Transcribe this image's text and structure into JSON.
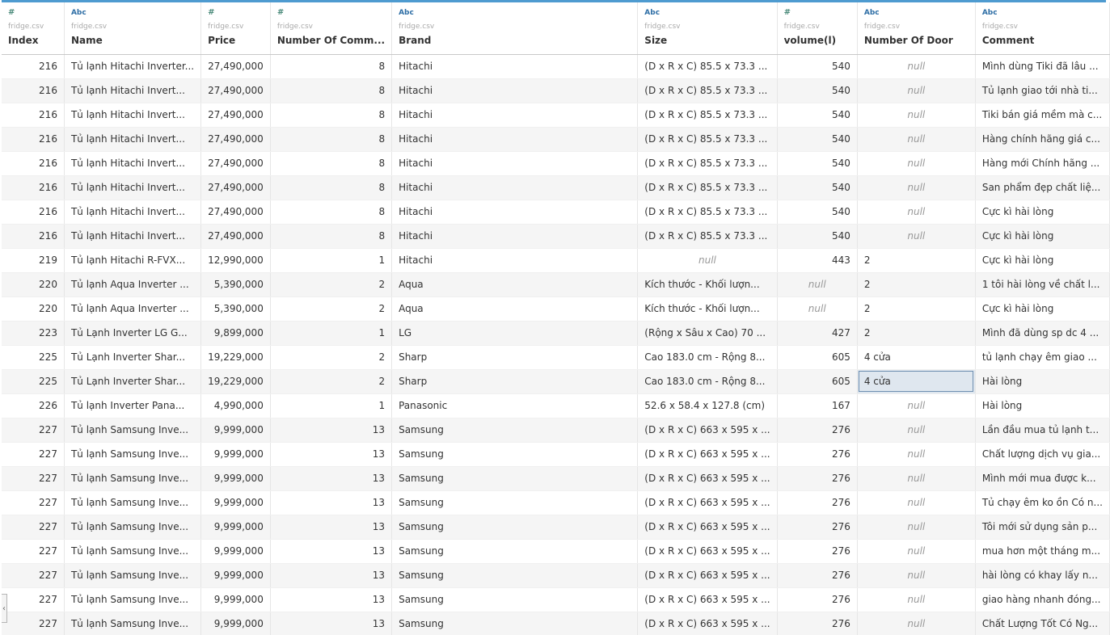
{
  "columns": [
    {
      "type": "#",
      "source": "fridge.csv",
      "name": "Index"
    },
    {
      "type": "Abc",
      "source": "fridge.csv",
      "name": "Name"
    },
    {
      "type": "#",
      "source": "fridge.csv",
      "name": "Price"
    },
    {
      "type": "#",
      "source": "fridge.csv",
      "name": "Number Of Comm..."
    },
    {
      "type": "Abc",
      "source": "fridge.csv",
      "name": "Brand"
    },
    {
      "type": "Abc",
      "source": "fridge.csv",
      "name": "Size"
    },
    {
      "type": "#",
      "source": "fridge.csv",
      "name": "volume(l)"
    },
    {
      "type": "Abc",
      "source": "fridge.csv",
      "name": "Number Of Door"
    },
    {
      "type": "Abc",
      "source": "fridge.csv",
      "name": "Comment"
    }
  ],
  "rows": [
    [
      "216",
      "Tủ lạnh Hitachi Inverter...",
      "27,490,000",
      "8",
      "Hitachi",
      "(D x R x C) 85.5 x 73.3 ...",
      "540",
      "null",
      "Mình dùng Tiki đã lâu ..."
    ],
    [
      "216",
      "Tủ lạnh Hitachi Invert...",
      "27,490,000",
      "8",
      "Hitachi",
      "(D x R x C) 85.5 x 73.3 ...",
      "540",
      "null",
      "Tủ lạnh giao tới nhà ti..."
    ],
    [
      "216",
      "Tủ lạnh Hitachi Invert...",
      "27,490,000",
      "8",
      "Hitachi",
      "(D x R x C) 85.5 x 73.3 ...",
      "540",
      "null",
      "Tiki bán giá mềm mà c..."
    ],
    [
      "216",
      "Tủ lạnh Hitachi Invert...",
      "27,490,000",
      "8",
      "Hitachi",
      "(D x R x C) 85.5 x 73.3 ...",
      "540",
      "null",
      "Hàng chính hãng giá c..."
    ],
    [
      "216",
      "Tủ lạnh Hitachi Invert...",
      "27,490,000",
      "8",
      "Hitachi",
      "(D x R x C) 85.5 x 73.3 ...",
      "540",
      "null",
      "Hàng mới  Chính hãng ..."
    ],
    [
      "216",
      "Tủ lạnh Hitachi Invert...",
      "27,490,000",
      "8",
      "Hitachi",
      "(D x R x C) 85.5 x 73.3 ...",
      "540",
      "null",
      "San phẩm đẹp chất liệ..."
    ],
    [
      "216",
      "Tủ lạnh Hitachi Invert...",
      "27,490,000",
      "8",
      "Hitachi",
      "(D x R x C) 85.5 x 73.3 ...",
      "540",
      "null",
      "Cực kì hài lòng"
    ],
    [
      "216",
      "Tủ lạnh Hitachi Invert...",
      "27,490,000",
      "8",
      "Hitachi",
      "(D x R x C) 85.5 x 73.3 ...",
      "540",
      "null",
      "Cực kì hài lòng"
    ],
    [
      "219",
      "Tủ lạnh Hitachi R-FVX...",
      "12,990,000",
      "1",
      "Hitachi",
      "null",
      "443",
      "2",
      "Cực kì hài lòng"
    ],
    [
      "220",
      "Tủ lạnh Aqua Inverter ...",
      "5,390,000",
      "2",
      "Aqua",
      "Kích thước - Khối lượn...",
      "null",
      "2",
      "1 tôi hài lòng về chất l..."
    ],
    [
      "220",
      "Tủ lạnh Aqua Inverter ...",
      "5,390,000",
      "2",
      "Aqua",
      "Kích thước - Khối lượn...",
      "null",
      "2",
      "Cực kì hài lòng"
    ],
    [
      "223",
      "Tủ Lạnh Inverter LG G...",
      "9,899,000",
      "1",
      "LG",
      "(Rộng x Sâu x Cao) 70 ...",
      "427",
      "2",
      "Mình đã dùng sp dc 4 ..."
    ],
    [
      "225",
      "Tủ Lạnh Inverter Shar...",
      "19,229,000",
      "2",
      "Sharp",
      "Cao 183.0 cm - Rộng 8...",
      "605",
      "4 cửa",
      "tủ lạnh chạy êm giao ..."
    ],
    [
      "225",
      "Tủ Lạnh Inverter Shar...",
      "19,229,000",
      "2",
      "Sharp",
      "Cao 183.0 cm - Rộng 8...",
      "605",
      "4 cửa",
      "Hài lòng"
    ],
    [
      "226",
      "Tủ lạnh Inverter Pana...",
      "4,990,000",
      "1",
      "Panasonic",
      "52.6 x 58.4 x 127.8 (cm)",
      "167",
      "null",
      "Hài lòng"
    ],
    [
      "227",
      "Tủ lạnh Samsung Inve...",
      "9,999,000",
      "13",
      "Samsung",
      "(D x R x C) 663 x 595 x ...",
      "276",
      "null",
      "Lần đầu mua tủ lạnh t..."
    ],
    [
      "227",
      "Tủ lạnh Samsung Inve...",
      "9,999,000",
      "13",
      "Samsung",
      "(D x R x C) 663 x 595 x ...",
      "276",
      "null",
      "Chất lượng dịch vụ gia..."
    ],
    [
      "227",
      "Tủ lạnh Samsung Inve...",
      "9,999,000",
      "13",
      "Samsung",
      "(D x R x C) 663 x 595 x ...",
      "276",
      "null",
      "Mình mới mua được k..."
    ],
    [
      "227",
      "Tủ lạnh Samsung Inve...",
      "9,999,000",
      "13",
      "Samsung",
      "(D x R x C) 663 x 595 x ...",
      "276",
      "null",
      "Tủ chạy êm ko ồn Có n..."
    ],
    [
      "227",
      "Tủ lạnh Samsung Inve...",
      "9,999,000",
      "13",
      "Samsung",
      "(D x R x C) 663 x 595 x ...",
      "276",
      "null",
      "Tôi mới sử dụng sản p..."
    ],
    [
      "227",
      "Tủ lạnh Samsung Inve...",
      "9,999,000",
      "13",
      "Samsung",
      "(D x R x C) 663 x 595 x ...",
      "276",
      "null",
      "mua hơn một tháng m..."
    ],
    [
      "227",
      "Tủ lạnh Samsung Inve...",
      "9,999,000",
      "13",
      "Samsung",
      "(D x R x C) 663 x 595 x ...",
      "276",
      "null",
      "hài lòng có khay lấy n..."
    ],
    [
      "227",
      "Tủ lạnh Samsung Inve...",
      "9,999,000",
      "13",
      "Samsung",
      "(D x R x C) 663 x 595 x ...",
      "276",
      "null",
      "giao hàng nhanh đóng..."
    ],
    [
      "227",
      "Tủ lạnh Samsung Inve...",
      "9,999,000",
      "13",
      "Samsung",
      "(D x R x C) 663 x 595 x ...",
      "276",
      "null",
      "Chất Lượng Tốt Có Ng..."
    ]
  ],
  "selected_cell": {
    "row": 13,
    "col": 7
  },
  "colors": {
    "accent_bar": "#4e9bd0",
    "number_icon": "#4a8a7a",
    "text_icon": "#2f6fa6"
  }
}
